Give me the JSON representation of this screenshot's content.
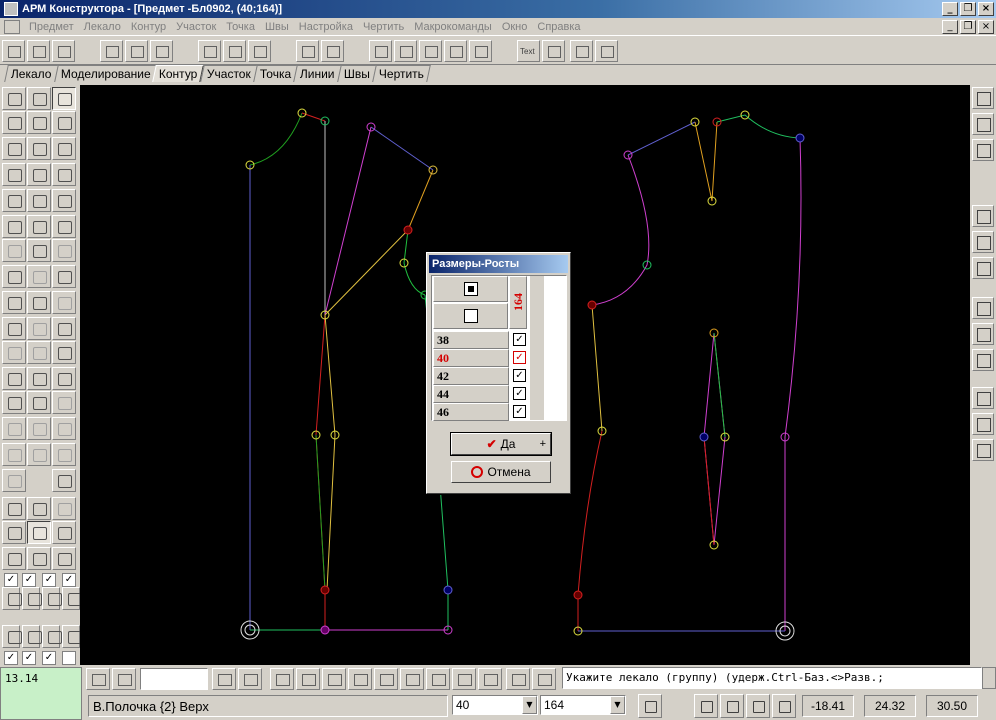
{
  "window": {
    "title": "АРМ Конструктора - [Предмет -Бл0902, (40;164)]"
  },
  "menu": [
    "Предмет",
    "Лекало",
    "Контур",
    "Участок",
    "Точка",
    "Швы",
    "Настройка",
    "Чертить",
    "Макрокоманды",
    "Окно",
    "Справка"
  ],
  "tabs": [
    "Лекало",
    "Моделирование",
    "Контур",
    "Участок",
    "Точка",
    "Линии",
    "Швы",
    "Чертить"
  ],
  "active_tab": "Контур",
  "dialog": {
    "title": "Размеры-Росты",
    "height_col": "164",
    "sizes": [
      {
        "label": "38",
        "checked": "✓",
        "current": false
      },
      {
        "label": "40",
        "checked": "✓",
        "current": true
      },
      {
        "label": "42",
        "checked": "✓",
        "current": false
      },
      {
        "label": "44",
        "checked": "✓",
        "current": false
      },
      {
        "label": "46",
        "checked": "✓",
        "current": false
      }
    ],
    "ok_label": "Да",
    "ok_plus": "+",
    "cancel_label": "Отмена"
  },
  "coord_readout": "13.14",
  "command_prompt": "Укажите лекало (группу) (удерж.Ctrl-Баз.<>Разв.;",
  "status": {
    "piece_name": "В.Полочка {2} Верх",
    "size_value": "40",
    "height_value": "164",
    "x": "-18.41",
    "y": "24.32",
    "angle": "30.50"
  },
  "colors": {
    "canvas_bg": "#000000",
    "title_bar": "#0a246a",
    "current_size": "#d40000",
    "coord_bg": "#c8f0c8"
  },
  "icons": {
    "ok": "checkmark-icon",
    "cancel": "prohibited-icon"
  }
}
